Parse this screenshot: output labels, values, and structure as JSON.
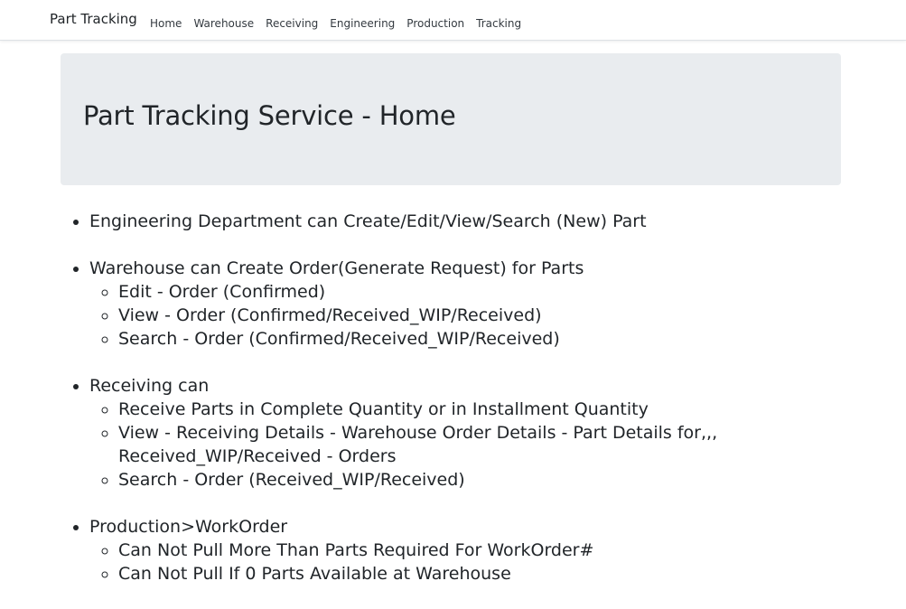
{
  "navbar": {
    "brand": "Part Tracking",
    "links": [
      "Home",
      "Warehouse",
      "Receiving",
      "Engineering",
      "Production",
      "Tracking"
    ]
  },
  "jumbotron": {
    "title": "Part Tracking Service - Home"
  },
  "features": [
    {
      "text": "Engineering Department can Create/Edit/View/Search (New) Part",
      "sub": []
    },
    {
      "text": "Warehouse can Create Order(Generate Request) for Parts",
      "sub": [
        "Edit - Order (Confirmed)",
        "View - Order (Confirmed/Received_WIP/Received)",
        "Search - Order (Confirmed/Received_WIP/Received)"
      ]
    },
    {
      "text": "Receiving can",
      "sub": [
        "Receive Parts in Complete Quantity or in Installment Quantity",
        "View - Receiving Details - Warehouse Order Details - Part Details for,,, Received_WIP/Received - Orders",
        "Search - Order (Received_WIP/Received)"
      ]
    },
    {
      "text": "Production>WorkOrder",
      "sub": [
        "Can Not Pull More Than Parts Required For WorkOrder#",
        "Can Not Pull If 0 Parts Available at Warehouse"
      ]
    }
  ]
}
